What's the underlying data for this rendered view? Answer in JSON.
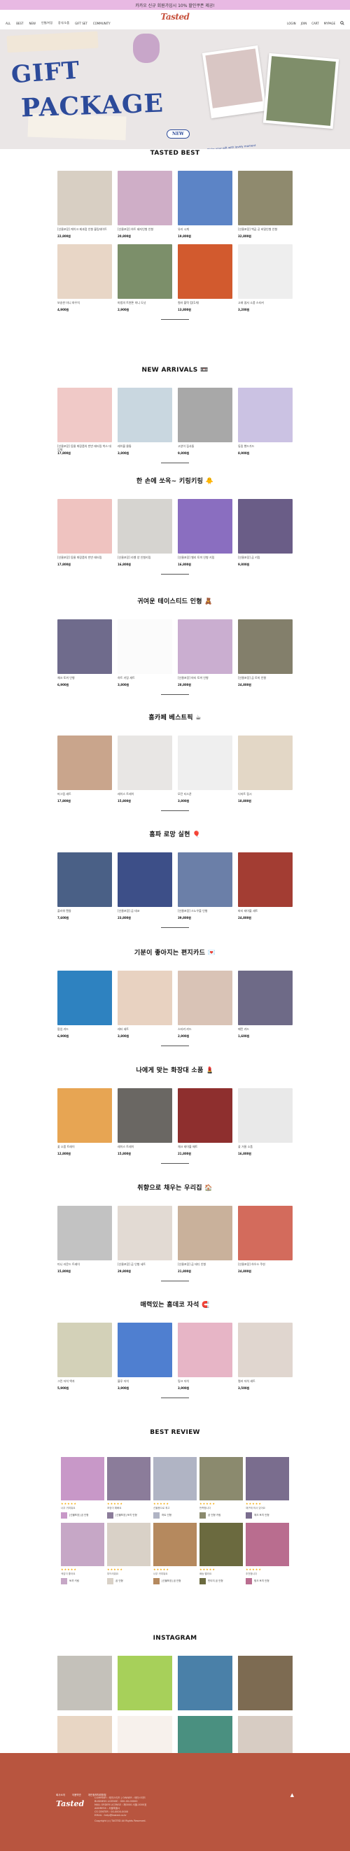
{
  "topbar": {
    "text": "카카오 신규 회원가입시 10% 할인쿠폰 제공!"
  },
  "header": {
    "logo": "Tasted",
    "nav_left": [
      "ALL",
      "BEST",
      "NEW",
      "인형/키링",
      "장식/소품",
      "GIFT SET",
      "COMMUNITY"
    ],
    "nav_right": [
      "LOGIN",
      "JOIN",
      "CART",
      "MYPAGE"
    ]
  },
  "hero": {
    "title1": "GIFT",
    "title2": "PACKAGE",
    "badge": "NEW",
    "caption": "Make your gift with lovely moment"
  },
  "sections": [
    {
      "title": "TASTED BEST",
      "items": [
        {
          "name": "[선물포장] 케이크 제과점 인형 블링데이트",
          "price": "22,800원",
          "color": "#d8cfc3"
        },
        {
          "name": "[선물포장] 하트 돼지인형 인형",
          "price": "20,800원",
          "color": "#cfaec7"
        },
        {
          "name": "유리 시계",
          "price": "19,800원",
          "color": "#5c84c6"
        },
        {
          "name": "[선물포장] 백곰 공 비밀인형 인형",
          "price": "32,800원",
          "color": "#8f8a6e"
        },
        {
          "name": "보송한 미니 파우치",
          "price": "4,900원",
          "color": "#e8d6c6"
        },
        {
          "name": "마법의 트윈톤 미니 도넛",
          "price": "2,900원",
          "color": "#7c8f6a"
        },
        {
          "name": "컬러 블럭 컵(1개)",
          "price": "13,800원",
          "color": "#d25a2e"
        },
        {
          "name": "고래 엽서 소품 스티커",
          "price": "3,200원",
          "color": "#eeeeee"
        }
      ]
    },
    {
      "title": "NEW ARRIVALS 📼",
      "items": [
        {
          "name": "[선물포장] 동물 화장품의 반반 레터링 박스 대 입체",
          "price": "17,800원",
          "color": "#f0c9c7"
        },
        {
          "name": "레이블 물통",
          "price": "3,800원",
          "color": "#c9d7e0"
        },
        {
          "name": "고양이 집사들",
          "price": "9,800원",
          "color": "#a8a8a8"
        },
        {
          "name": "튜링 핸드가드",
          "price": "8,900원",
          "color": "#cbc2e3"
        }
      ]
    },
    {
      "title": "한 손에 쏘옥~ 키링키링 🐥",
      "items": [
        {
          "name": "[선물포장] 동물 화장품의 반반 레터링",
          "price": "17,800원",
          "color": "#efc3c0"
        },
        {
          "name": "[선물포장] 라벨 양 인형키링",
          "price": "16,800원",
          "color": "#d6d4d0"
        },
        {
          "name": "[선물포장] 벨리 토끼 인형 키링",
          "price": "16,800원",
          "color": "#8a6ec0"
        },
        {
          "name": "[선물포장] 곰 키링",
          "price": "9,800원",
          "color": "#6a5d87"
        }
      ]
    },
    {
      "title": "귀여운 테이스티드 인형 🧸",
      "items": [
        {
          "name": "체크 토끼 인형",
          "price": "6,900원",
          "color": "#6f6b8c"
        },
        {
          "name": "하트 키링 세트",
          "price": "3,800원",
          "color": "#fbfbfb"
        },
        {
          "name": "[선물포장] 마티 토끼 인형",
          "price": "28,800원",
          "color": "#caaed0"
        },
        {
          "name": "[선물포장] 곰 토끼 인형",
          "price": "24,800원",
          "color": "#837f6b"
        }
      ]
    },
    {
      "title": "홈카페 베스트픽 ☕",
      "items": [
        {
          "name": "머그컵 세트",
          "price": "17,800원",
          "color": "#c9a58c"
        },
        {
          "name": "레이스 트레이",
          "price": "15,800원",
          "color": "#e8e6e4"
        },
        {
          "name": "모던 티스푼",
          "price": "3,800원",
          "color": "#efefef"
        },
        {
          "name": "디저트 접시",
          "price": "18,800원",
          "color": "#e3d7c6"
        }
      ]
    },
    {
      "title": "홈파 로망 실현 🎈",
      "items": [
        {
          "name": "플라워 캔들",
          "price": "7,600원",
          "color": "#4a6086"
        },
        {
          "name": "[선물포장] 곰 데코",
          "price": "23,800원",
          "color": "#3d4f88"
        },
        {
          "name": "[선물포장] 스노우볼 인형",
          "price": "39,800원",
          "color": "#6b7fa8"
        },
        {
          "name": "파티 테이블 세트",
          "price": "24,800원",
          "color": "#a33d33"
        }
      ]
    },
    {
      "title": "기분이 좋아지는 편지카드 💌",
      "items": [
        {
          "name": "팝업 카드",
          "price": "6,900원",
          "color": "#2e82c0"
        },
        {
          "name": "레터 세트",
          "price": "3,800원",
          "color": "#e8d2c1"
        },
        {
          "name": "스티커 카드",
          "price": "2,900원",
          "color": "#d9c3b6"
        },
        {
          "name": "패턴 카드",
          "price": "1,600원",
          "color": "#6e6a87"
        }
      ]
    },
    {
      "title": "나에게 맞는 화장대 소품 💄",
      "items": [
        {
          "name": "꽃 소품 트레이",
          "price": "12,800원",
          "color": "#e7a553"
        },
        {
          "name": "레이스 트레이",
          "price": "15,800원",
          "color": "#6a6763"
        },
        {
          "name": "체크 테이블 매트",
          "price": "21,800원",
          "color": "#8e2f2e"
        },
        {
          "name": "꽃 거울 소품",
          "price": "16,800원",
          "color": "#e9e9e9"
        }
      ]
    },
    {
      "title": "취향으로 채우는 우리집 🏠",
      "items": [
        {
          "name": "미니 라운드 트레이",
          "price": "15,800원",
          "color": "#c2c2c2"
        },
        {
          "name": "[선물포장] 곰 인형 세트",
          "price": "29,800원",
          "color": "#e2dad3"
        },
        {
          "name": "[선물포장] 곰 테디 인형",
          "price": "21,800원",
          "color": "#c9b19b"
        },
        {
          "name": "[선물포장] 하우스 쿠션",
          "price": "24,800원",
          "color": "#d36b5c"
        }
      ]
    },
    {
      "title": "매력있는 홈데코 자석 🧲",
      "items": [
        {
          "name": "그린 자석 액자",
          "price": "5,900원",
          "color": "#d3d1b8"
        },
        {
          "name": "블루 자석",
          "price": "3,900원",
          "color": "#4f7fd0"
        },
        {
          "name": "핑크 자석",
          "price": "3,900원",
          "color": "#e7b5c6"
        },
        {
          "name": "컬러 자석 세트",
          "price": "3,500원",
          "color": "#e0d6cf"
        }
      ]
    }
  ],
  "reviews": {
    "title": "BEST REVIEW",
    "stars": "★★★★★",
    "items": [
      {
        "color": "#c898c8",
        "text": "너무 귀여워요",
        "prod": "[선물포장] 곰 인형"
      },
      {
        "color": "#8b7c9a",
        "text": "포장이 예뻐요",
        "prod": "[선물포장] 토끼 인형"
      },
      {
        "color": "#b0b4c4",
        "text": "선물용으로 최고",
        "prod": "하트 인형"
      },
      {
        "color": "#8b8a6e",
        "text": "만족합니다",
        "prod": "곰 인형 키링"
      },
      {
        "color": "#7a6d8e",
        "text": "재구매 의사 있어요",
        "prod": "체크 토끼 인형"
      },
      {
        "color": "#c6a7c6",
        "text": "색감이 좋아요",
        "prod": "토끼 키링"
      },
      {
        "color": "#d9d1c7",
        "text": "부드러워요",
        "prod": "곰 인형"
      },
      {
        "color": "#b5895e",
        "text": "너무 귀여워요",
        "prod": "[선물포장] 곰 인형"
      },
      {
        "color": "#6b6a3f",
        "text": "배송 빨라요",
        "prod": "빈티지 곰 인형"
      },
      {
        "color": "#b96d8f",
        "text": "추천합니다",
        "prod": "핑크 토끼 인형"
      }
    ]
  },
  "instagram": {
    "title": "INSTAGRAM",
    "colors": [
      "#c4c1ba",
      "#a7d05a",
      "#4a80a8",
      "#7d6b52",
      "#e8d6c4",
      "#f7f1ec",
      "#4a9080",
      "#d7ccc3"
    ]
  },
  "footer": {
    "logo": "Tasted",
    "links": [
      "회사소개",
      "이용약관",
      "개인정보처리방침"
    ],
    "info": [
      "COMPANY : 테이스티드 | OWNER : 테이스티드",
      "BUSINESS LICENSE : 000-00-00000",
      "MAIL ORDER LICENSE : 제0000-서울-0000호",
      "ADDRESS : 서울특별시",
      "CS CENTER : 00-0000-0000",
      "EMAIL : help@tasted.co.kr"
    ],
    "copyright": "Copyright (c) TASTED All Rights Reserved.",
    "top": "▲"
  }
}
